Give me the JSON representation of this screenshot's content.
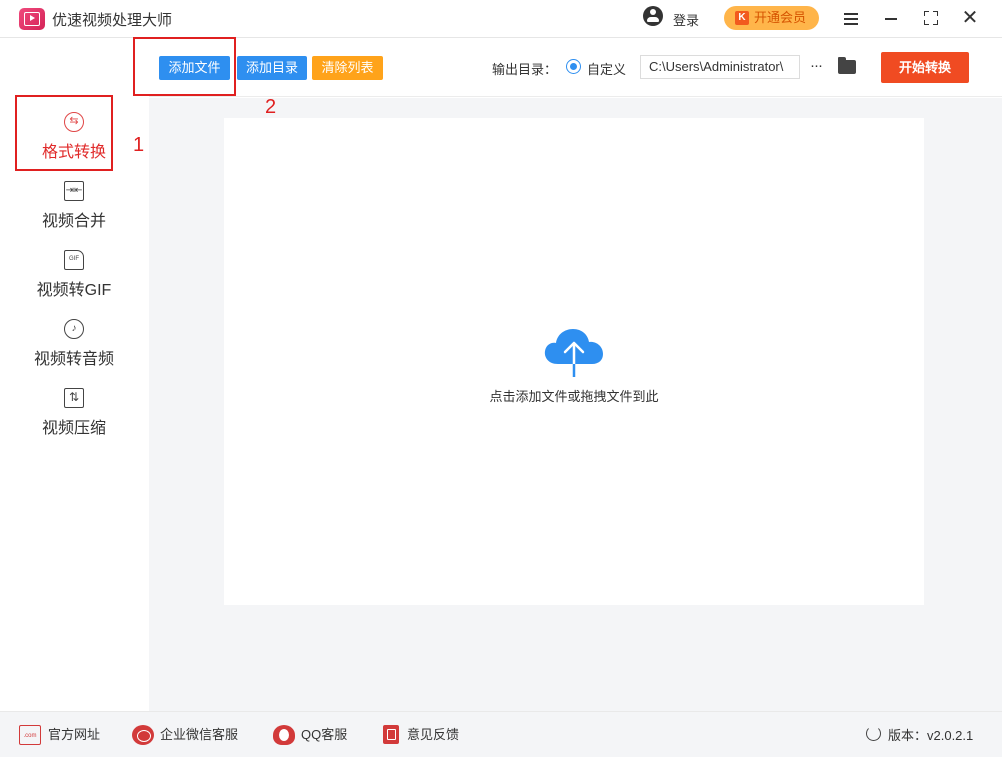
{
  "titlebar": {
    "app_title": "优速视频处理大师",
    "login_label": "登录",
    "vip_label": "开通会员",
    "vip_badge": "K"
  },
  "sidebar": {
    "items": [
      {
        "label": "格式转换",
        "icon": "format-convert-icon",
        "active": true
      },
      {
        "label": "视频合并",
        "icon": "video-merge-icon",
        "active": false
      },
      {
        "label": "视频转GIF",
        "icon": "gif-file-icon",
        "active": false
      },
      {
        "label": "视频转音频",
        "icon": "audio-icon",
        "active": false
      },
      {
        "label": "视频压缩",
        "icon": "compress-icon",
        "active": false
      }
    ]
  },
  "toolbar": {
    "add_file_label": "添加文件",
    "add_dir_label": "添加目录",
    "clear_list_label": "清除列表",
    "output_dir_label": "输出目录：",
    "custom_label": "自定义",
    "output_path": "C:\\Users\\Administrator\\",
    "more_label": "···",
    "start_label": "开始转换"
  },
  "content": {
    "drop_hint": "点击添加文件或拖拽文件到此"
  },
  "annotations": {
    "step1": "1",
    "step2": "2"
  },
  "footer": {
    "website_label": "官方网址",
    "website_icon_text": ".com",
    "wecom_label": "企业微信客服",
    "qq_label": "QQ客服",
    "feedback_label": "意见反馈",
    "version_label": "版本：v2.0.2.1"
  },
  "colors": {
    "primary_blue": "#2e8ff0",
    "orange": "#ffa31a",
    "start_red": "#f04b22",
    "annotation_red": "#e02020",
    "vip_gold": "#ffb54a"
  }
}
